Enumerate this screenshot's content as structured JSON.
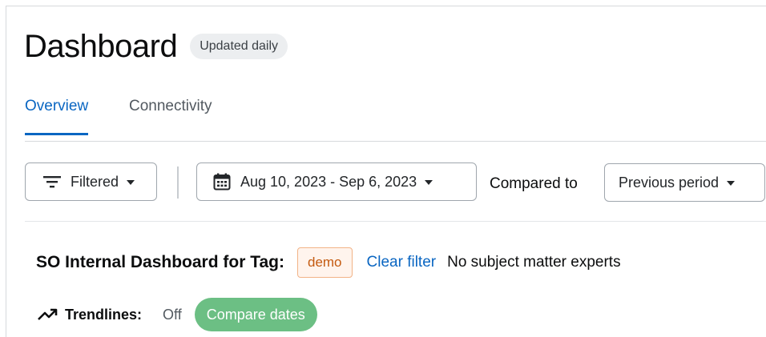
{
  "header": {
    "title": "Dashboard",
    "badge": "Updated daily"
  },
  "tabs": [
    {
      "label": "Overview",
      "active": true
    },
    {
      "label": "Connectivity",
      "active": false
    }
  ],
  "toolbar": {
    "filter_label": "Filtered",
    "date_range": "Aug 10, 2023 - Sep 6, 2023",
    "compared_label": "Compared to",
    "period_label": "Previous period"
  },
  "tag_bar": {
    "title": "SO Internal Dashboard for Tag:",
    "tag": "demo",
    "clear_filter": "Clear filter",
    "experts_text": "No subject matter experts"
  },
  "trendlines": {
    "label": "Trendlines:",
    "off_label": "Off",
    "compare_button": "Compare dates"
  },
  "colors": {
    "accent": "#0a66c2",
    "tag_text": "#c45a10",
    "tag_border": "#f2b387",
    "compare_green": "#6cbf84"
  },
  "icons": {
    "filter": "filter-lines-icon",
    "calendar": "calendar-icon",
    "trend": "trend-up-icon",
    "dropdown": "caret-down-icon"
  }
}
